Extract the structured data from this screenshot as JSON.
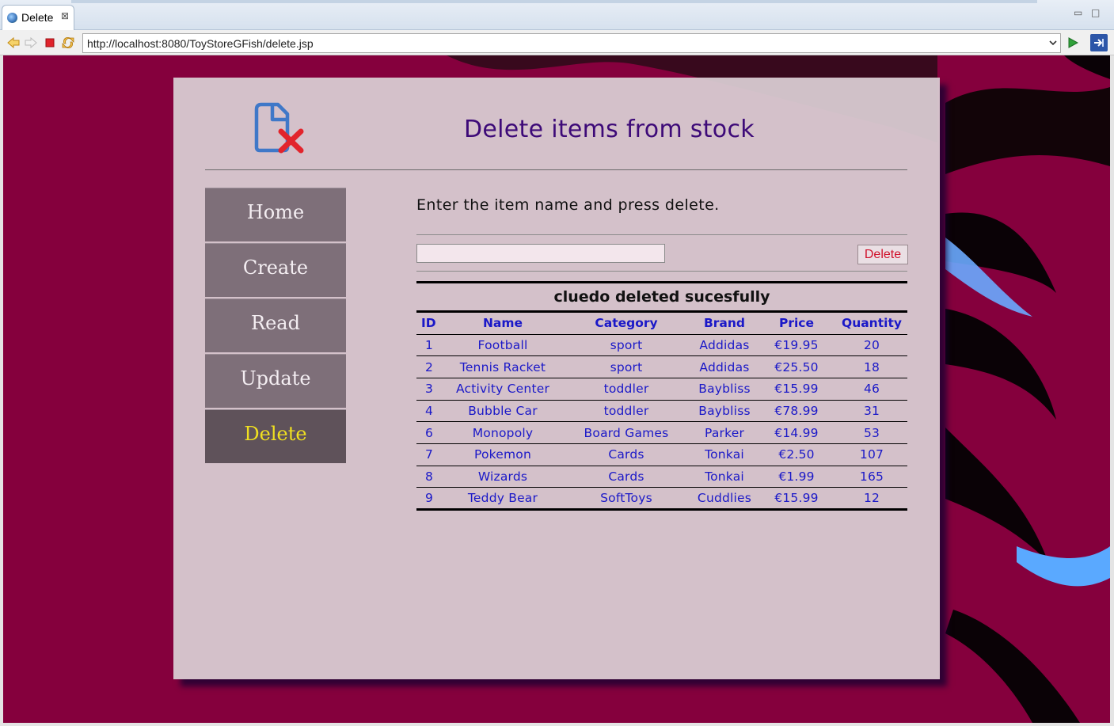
{
  "tab": {
    "title": "Delete",
    "close_glyph": "⊠"
  },
  "window_controls": {
    "minimize": "▭",
    "maximize": "□"
  },
  "toolbar": {
    "url": "http://localhost:8080/ToyStoreGFish/delete.jsp",
    "icons": [
      "back-icon",
      "forward-icon",
      "stop-icon",
      "refresh-icon",
      "go-icon",
      "external-browser-icon"
    ]
  },
  "page": {
    "title": "Delete items from stock",
    "logo_icon": "document-delete-icon",
    "nav": [
      {
        "label": "Home",
        "active": false
      },
      {
        "label": "Create",
        "active": false
      },
      {
        "label": "Read",
        "active": false
      },
      {
        "label": "Update",
        "active": false
      },
      {
        "label": "Delete",
        "active": true
      }
    ],
    "instructions": "Enter the item name and press delete.",
    "item_input": {
      "value": "",
      "placeholder": ""
    },
    "delete_button": "Delete",
    "message": "cluedo deleted sucesfully",
    "table": {
      "headers": [
        "ID",
        "Name",
        "Category",
        "Brand",
        "Price",
        "Quantity"
      ],
      "rows": [
        [
          "1",
          "Football",
          "sport",
          "Addidas",
          "€19.95",
          "20"
        ],
        [
          "2",
          "Tennis Racket",
          "sport",
          "Addidas",
          "€25.50",
          "18"
        ],
        [
          "3",
          "Activity Center",
          "toddler",
          "Baybliss",
          "€15.99",
          "46"
        ],
        [
          "4",
          "Bubble Car",
          "toddler",
          "Baybliss",
          "€78.99",
          "31"
        ],
        [
          "6",
          "Monopoly",
          "Board Games",
          "Parker",
          "€14.99",
          "53"
        ],
        [
          "7",
          "Pokemon",
          "Cards",
          "Tonkai",
          "€2.50",
          "107"
        ],
        [
          "8",
          "Wizards",
          "Cards",
          "Tonkai",
          "€1.99",
          "165"
        ],
        [
          "9",
          "Teddy Bear",
          "SoftToys",
          "Cuddlies",
          "€15.99",
          "12"
        ]
      ]
    }
  },
  "colors": {
    "background": "#85003d",
    "panel": "#d8cbd2",
    "title": "#3d0a78",
    "nav": "#7e6f79",
    "nav_active": "#5f525a",
    "nav_active_text": "#f0e020",
    "table_text": "#1a18c8",
    "delete_text": "#d0102a"
  }
}
